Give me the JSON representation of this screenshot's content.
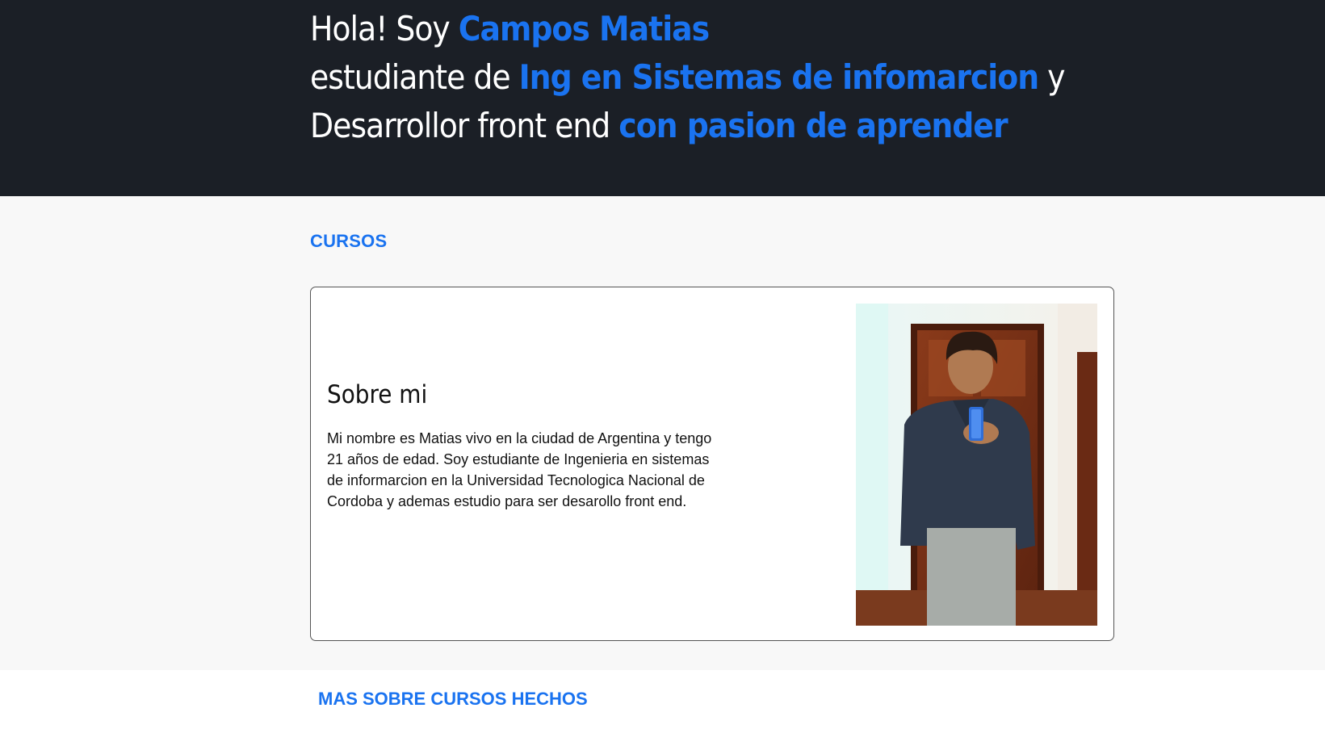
{
  "hero": {
    "line1_plain": "Hola! Soy ",
    "line1_accent": "Campos Matias",
    "line2_plain": "estudiante de ",
    "line2_accent": "Ing en Sistemas de infomarcion",
    "line2_tail": " y",
    "line3_plain": "Desarrollor front end ",
    "line3_accent": "con pasion de aprender"
  },
  "cursos": {
    "section_title": "CURSOS"
  },
  "about": {
    "title": "Sobre mi",
    "body": "Mi nombre es Matias vivo en la ciudad de Argentina y tengo 21 años de edad. Soy estudiante de Ingenieria en sistemas de informarcion en la Universidad Tecnologica Nacional de Cordoba y ademas estudio para ser desarollo front end."
  },
  "more": {
    "title": "MAS SOBRE CURSOS HECHOS"
  },
  "colors": {
    "hero_bg": "#1b1f26",
    "accent": "#1a73f0",
    "page_bg": "#f8f8f8"
  }
}
